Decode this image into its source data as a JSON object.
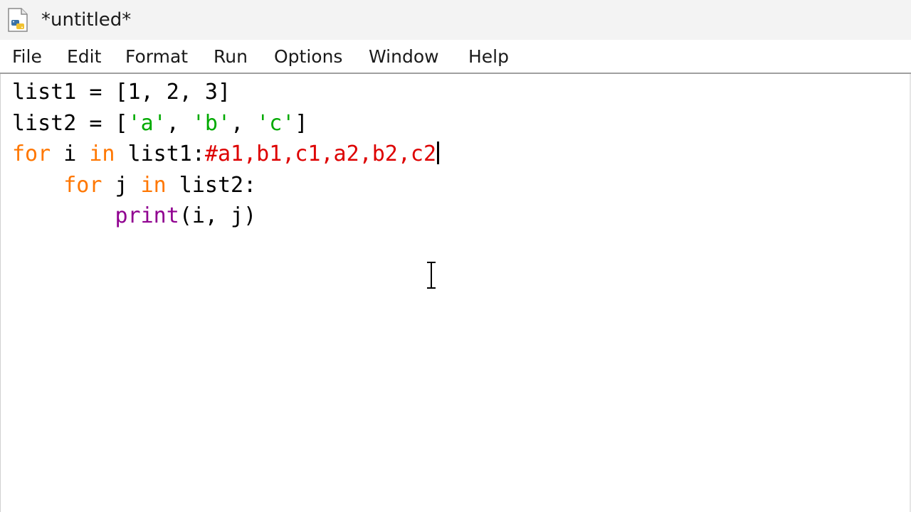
{
  "window": {
    "title": "*untitled*"
  },
  "menu": {
    "items": [
      "File",
      "Edit",
      "Format",
      "Run",
      "Options",
      "Window",
      "Help"
    ]
  },
  "editor": {
    "lines": [
      [
        {
          "t": "list1 = [1, 2, 3]",
          "c": "plain"
        }
      ],
      [
        {
          "t": "list2 = [",
          "c": "plain"
        },
        {
          "t": "'a'",
          "c": "str"
        },
        {
          "t": ", ",
          "c": "plain"
        },
        {
          "t": "'b'",
          "c": "str"
        },
        {
          "t": ", ",
          "c": "plain"
        },
        {
          "t": "'c'",
          "c": "str"
        },
        {
          "t": "]",
          "c": "plain"
        }
      ],
      [
        {
          "t": "for",
          "c": "kw"
        },
        {
          "t": " i ",
          "c": "plain"
        },
        {
          "t": "in",
          "c": "kw"
        },
        {
          "t": " list1:",
          "c": "plain"
        },
        {
          "t": "#a1,b1,c1,a2,b2,c2",
          "c": "cm"
        }
      ],
      [
        {
          "t": "    ",
          "c": "plain"
        },
        {
          "t": "for",
          "c": "kw"
        },
        {
          "t": " j ",
          "c": "plain"
        },
        {
          "t": "in",
          "c": "kw"
        },
        {
          "t": " list2:",
          "c": "plain"
        }
      ],
      [
        {
          "t": "        ",
          "c": "plain"
        },
        {
          "t": "print",
          "c": "bi"
        },
        {
          "t": "(i, j)",
          "c": "plain"
        }
      ]
    ],
    "caret_line": 2,
    "colors": {
      "keyword": "#ff7700",
      "string": "#00aa00",
      "comment": "#dd0000",
      "builtin": "#900090",
      "default": "#000000"
    }
  },
  "icons": {
    "app": "python-file-icon",
    "cursor": "text-cursor-icon"
  }
}
